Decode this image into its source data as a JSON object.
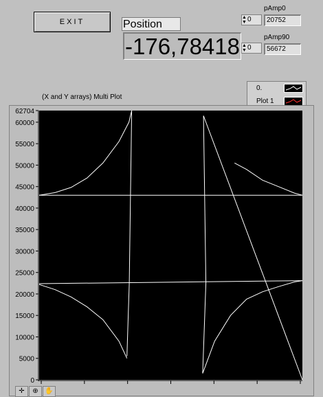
{
  "exit": {
    "label": "EXIT"
  },
  "position": {
    "label": "Position",
    "value": "-176,784180"
  },
  "spinners": [
    {
      "value": "0"
    },
    {
      "value": "0"
    }
  ],
  "pamp0": {
    "label": "pAmp0",
    "value": "20752"
  },
  "pamp90": {
    "label": "pAmp90",
    "value": "56672"
  },
  "plot": {
    "title": "(X and Y arrays) Multi Plot",
    "legend": [
      {
        "name": "0.",
        "color": "#ffffff"
      },
      {
        "name": "Plot 1",
        "color": "#ff3030"
      }
    ],
    "tools": [
      {
        "icon": "crosshair-icon",
        "glyph": "✛"
      },
      {
        "icon": "zoom-icon",
        "glyph": "⊕"
      },
      {
        "icon": "pan-hand-icon",
        "glyph": "✋"
      }
    ]
  },
  "chart_data": {
    "type": "line",
    "title": "(X and Y arrays) Multi Plot",
    "ylim": [
      0,
      62704
    ],
    "y_ticks": [
      0,
      5000,
      10000,
      15000,
      20000,
      25000,
      30000,
      35000,
      40000,
      45000,
      50000,
      55000,
      60000,
      62704
    ],
    "x_tick_count": 7,
    "grid": false,
    "legend_position": "top-right",
    "series": [
      {
        "name": "0.",
        "color": "#ffffff",
        "segments": [
          [
            [
              0,
              43000
            ],
            [
              0.4,
              43600
            ],
            [
              0.8,
              44800
            ],
            [
              1.2,
              47000
            ],
            [
              1.6,
              50500
            ],
            [
              2.0,
              55500
            ],
            [
              2.25,
              60000
            ],
            [
              2.32,
              62704
            ]
          ],
          [
            [
              0,
              22200
            ],
            [
              0.4,
              21000
            ],
            [
              0.8,
              19300
            ],
            [
              1.2,
              17000
            ],
            [
              1.6,
              14000
            ],
            [
              2.0,
              9000
            ],
            [
              2.2,
              5000
            ]
          ],
          [
            [
              2.32,
              62704
            ],
            [
              2.26,
              22500
            ],
            [
              2.2,
              5500
            ]
          ],
          [
            [
              0,
              43000
            ],
            [
              6.6,
              43000
            ]
          ],
          [
            [
              0,
              22400
            ],
            [
              6.6,
              23100
            ]
          ],
          [
            [
              4.12,
              61500
            ],
            [
              4.18,
              22500
            ],
            [
              4.1,
              1500
            ]
          ],
          [
            [
              4.12,
              61500
            ],
            [
              6.6,
              0
            ]
          ],
          [
            [
              4.1,
              1500
            ],
            [
              4.4,
              9000
            ],
            [
              4.8,
              15000
            ],
            [
              5.2,
              18800
            ],
            [
              5.6,
              20500
            ],
            [
              6.0,
              21700
            ],
            [
              6.4,
              22800
            ],
            [
              6.6,
              23100
            ]
          ],
          [
            [
              4.9,
              50500
            ],
            [
              5.2,
              49000
            ],
            [
              5.6,
              46500
            ],
            [
              6.0,
              45000
            ],
            [
              6.4,
              43500
            ],
            [
              6.6,
              43000
            ]
          ]
        ]
      }
    ]
  }
}
